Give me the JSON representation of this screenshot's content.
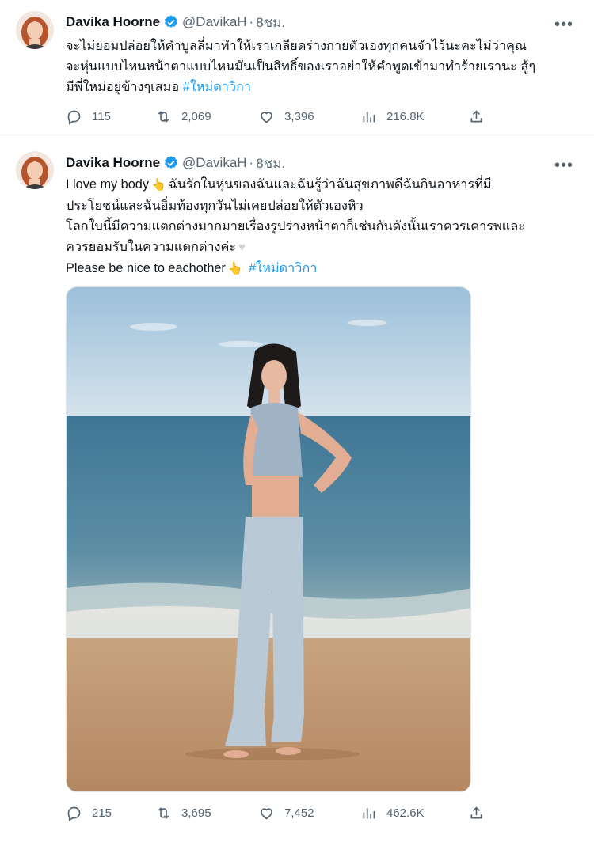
{
  "tweets": [
    {
      "author": {
        "name": "Davika Hoorne",
        "handle": "@DavikaH",
        "time": "8ชม."
      },
      "text_lines": [
        "จะไม่ยอมปล่อยให้คำบูลลี่มาทำให้เราเกลียดร่างกายตัวเองทุกคนจำไว้นะคะไม่ว่าคุณ",
        "จะหุ่นแบบไหนหน้าตาแบบไหนมันเป็นสิทธิ์ของเราอย่าให้คำพูดเข้ามาทำร้ายเรานะ สู้ๆ",
        "มีพี่ใหม่อยู่ข้างๆเสมอ"
      ],
      "hashtag": "#ใหม่ดาวิกา",
      "stats": {
        "replies": "115",
        "retweets": "2,069",
        "likes": "3,396",
        "views": "216.8K"
      }
    },
    {
      "author": {
        "name": "Davika Hoorne",
        "handle": "@DavikaH",
        "time": "8ชม."
      },
      "line1_a": "I love my body",
      "line1_b": "ฉันรักในหุ่นของฉันและฉันรู้ว่าฉันสุขภาพดีฉันกินอาหารที่มี",
      "line2": "ประโยชน์และฉันอิ่มท้องทุกวันไม่เคยปล่อยให้ตัวเองหิว",
      "line3": "โลกใบนี้มีความแตกต่างมากมายเรื่องรูปร่างหน้าตาก็เช่นกันดังนั้นเราควรเคารพและ",
      "line4": "ควรยอมรับในความแตกต่างค่ะ",
      "line5": "Please be nice to eachother",
      "hashtag": "#ใหม่ดาวิกา",
      "stats": {
        "replies": "215",
        "retweets": "3,695",
        "likes": "7,452",
        "views": "462.6K"
      }
    }
  ],
  "icons": {
    "verified": "verified-badge-icon",
    "more": "more-dots-icon",
    "reply": "reply-icon",
    "retweet": "retweet-icon",
    "like": "heart-icon",
    "views": "views-bar-chart-icon",
    "share": "share-icon",
    "point": "pointing-hand-emoji",
    "heart_emoji": "white-heart-emoji"
  },
  "colors": {
    "accent": "#1d9bf0",
    "text": "#0f1419",
    "muted": "#536471"
  }
}
